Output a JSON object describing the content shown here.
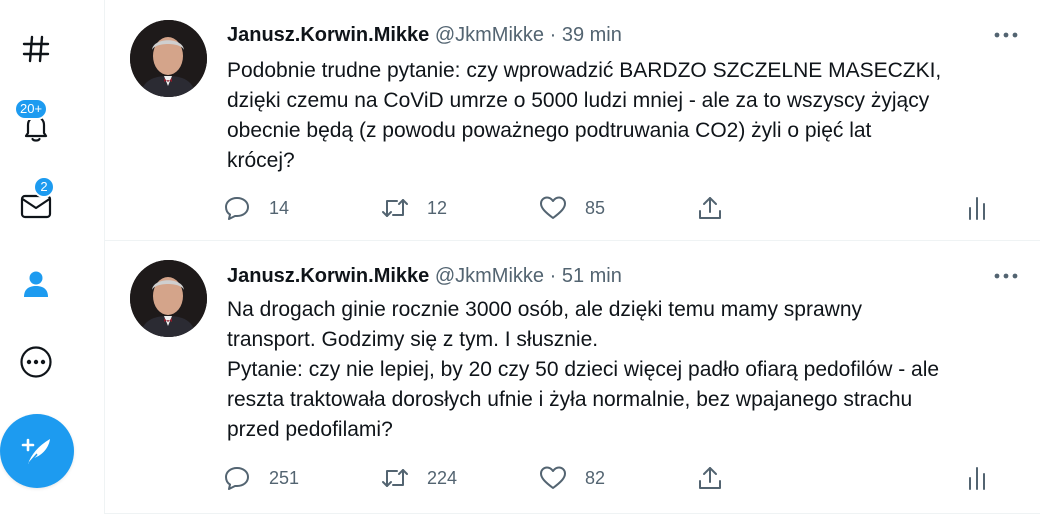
{
  "sidebar": {
    "notifications_badge": "20+",
    "messages_badge": "2"
  },
  "colors": {
    "accent": "#1d9bf0",
    "text_primary": "#0f1419",
    "text_secondary": "#536471",
    "divider": "#eff3f4"
  },
  "tweets": [
    {
      "author_name": "Janusz.Korwin.Mikke",
      "handle": "@JkmMikke",
      "separator": "·",
      "time": "39 min",
      "text": "Podobnie trudne pytanie: czy wprowadzić BARDZO SZCZELNE MASECZKI,\ndzięki czemu na CoViD umrze o 5000 ludzi mniej - ale za to wszyscy żyjący\nobecnie będą (z powodu poważnego podtruwania CO2) żyli o pięć lat\nkrócej?",
      "replies": "14",
      "retweets": "12",
      "likes": "85"
    },
    {
      "author_name": "Janusz.Korwin.Mikke",
      "handle": "@JkmMikke",
      "separator": "·",
      "time": "51 min",
      "text": "Na drogach ginie rocznie 3000 osób, ale dzięki temu mamy sprawny\ntransport. Godzimy się z tym. I słusznie.\nPytanie: czy nie lepiej, by 20 czy 50 dzieci więcej padło ofiarą pedofilów - ale\nreszta traktowała dorosłych ufnie i żyła normalnie, bez wpajanego strachu\nprzed pedofilami?",
      "replies": "251",
      "retweets": "224",
      "likes": "82"
    }
  ]
}
